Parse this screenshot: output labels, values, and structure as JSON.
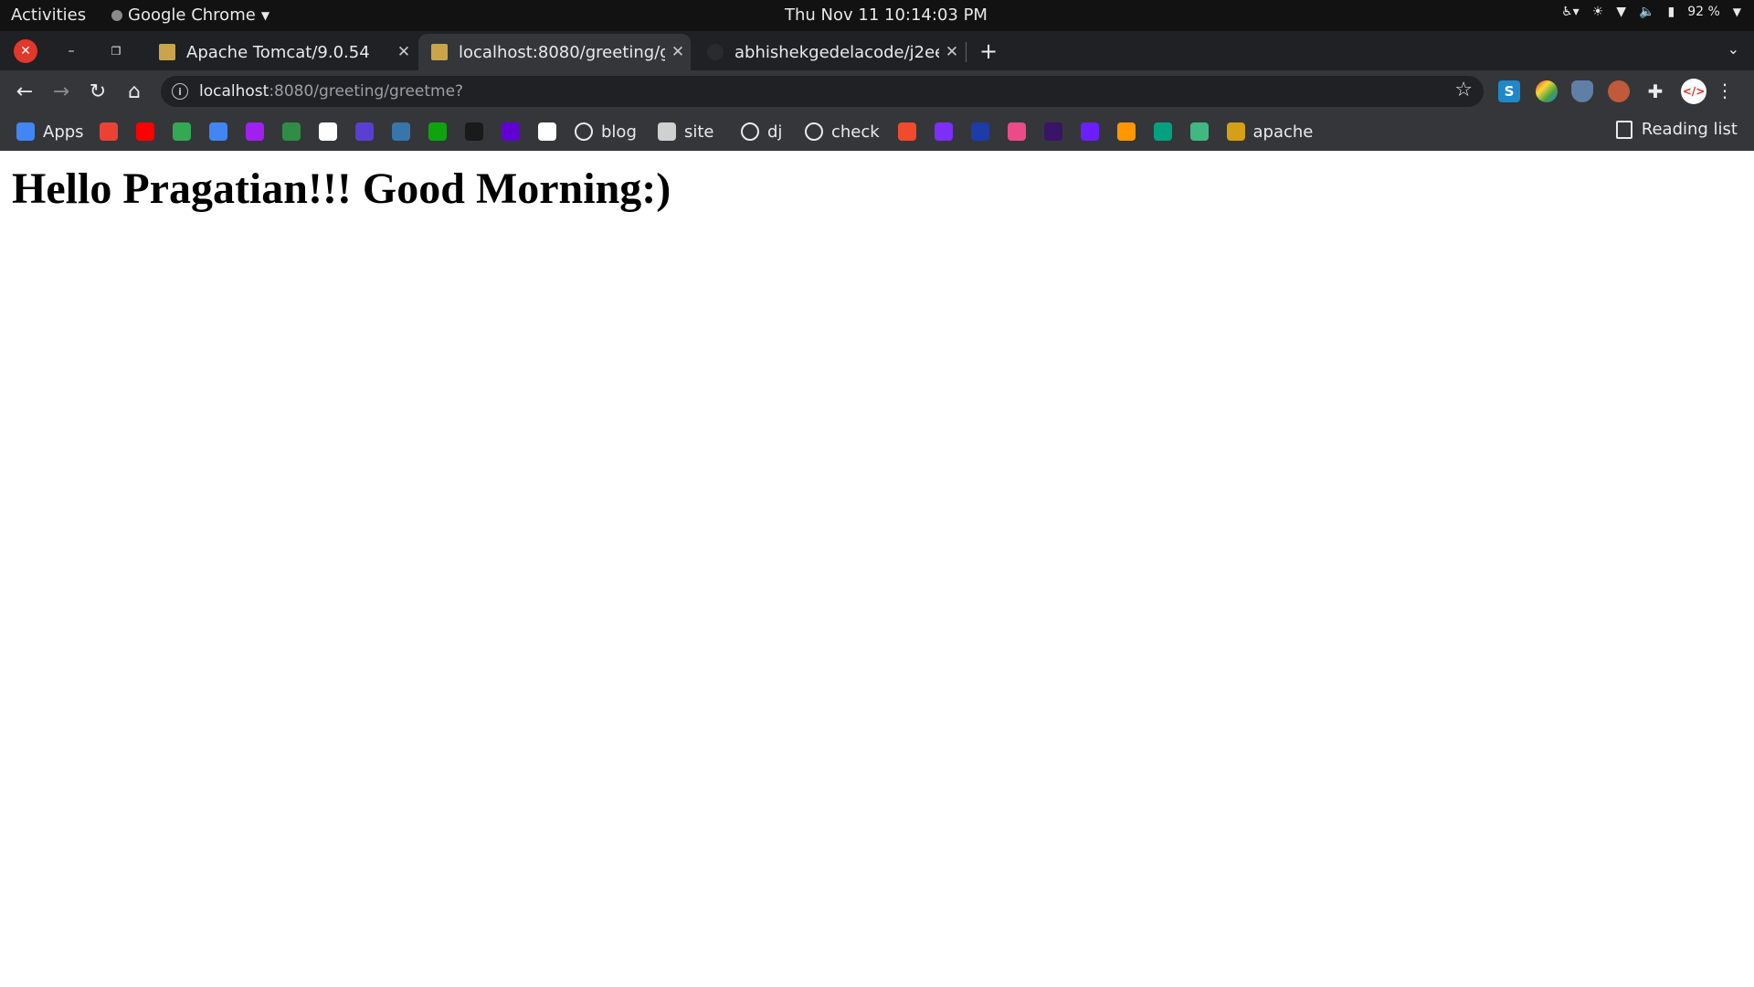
{
  "system_bar": {
    "activities": "Activities",
    "app_name": "Google Chrome",
    "clock": "Thu Nov 11  10:14:03 PM",
    "battery": "92 %"
  },
  "tabs": [
    {
      "title": "Apache Tomcat/9.0.54",
      "icon": "tomcat-icon",
      "active": false
    },
    {
      "title": "localhost:8080/greeting/g",
      "icon": "tomcat-icon",
      "active": true
    },
    {
      "title": "abhishekgedelacode/j2ee",
      "icon": "github-icon",
      "active": false
    }
  ],
  "address_bar": {
    "host": "localhost",
    "path": ":8080/greeting/greetme?"
  },
  "bookmarks": [
    {
      "label": "Apps",
      "icon": "apps-grid-icon",
      "color": "#4285f4"
    },
    {
      "label": "",
      "icon": "gmail-icon",
      "color": "#ea4335"
    },
    {
      "label": "",
      "icon": "youtube-icon",
      "color": "#ff0000"
    },
    {
      "label": "",
      "icon": "maps-icon",
      "color": "#34a853"
    },
    {
      "label": "",
      "icon": "translate-icon",
      "color": "#4285f4"
    },
    {
      "label": "",
      "icon": "app-f-icon",
      "color": "#a020f0"
    },
    {
      "label": "",
      "icon": "geeks-icon",
      "color": "#2f8d46"
    },
    {
      "label": "",
      "icon": "app-black-icon",
      "color": "#ffffff"
    },
    {
      "label": "",
      "icon": "app-purple-icon",
      "color": "#5b3fd1"
    },
    {
      "label": "",
      "icon": "python-icon",
      "color": "#3776ab"
    },
    {
      "label": "",
      "icon": "app-b-icon",
      "color": "#0fa30f"
    },
    {
      "label": "",
      "icon": "sf-icon",
      "color": "#1a1a1a"
    },
    {
      "label": "",
      "icon": "yahoo-icon",
      "color": "#6001d2"
    },
    {
      "label": "",
      "icon": "google-icon",
      "color": "#ffffff"
    },
    {
      "label": "blog",
      "icon": "globe-icon",
      "color": "#e8eaed"
    },
    {
      "label": "site",
      "icon": "code-icon",
      "color": "#d0d0d0"
    },
    {
      "label": "dj",
      "icon": "globe-icon",
      "color": "#e8eaed"
    },
    {
      "label": "check",
      "icon": "globe-icon",
      "color": "#e8eaed"
    },
    {
      "label": "",
      "icon": "app-orange-b-icon",
      "color": "#f24a2c"
    },
    {
      "label": "",
      "icon": "app-violet-icon",
      "color": "#7b2ff7"
    },
    {
      "label": "",
      "icon": "app-blue-icon",
      "color": "#1e3ca8"
    },
    {
      "label": "",
      "icon": "app-pink-icon",
      "color": "#ea4c89"
    },
    {
      "label": "",
      "icon": "app-dark-icon",
      "color": "#3a1466"
    },
    {
      "label": "",
      "icon": "app-square-icon",
      "color": "#6b1fff"
    },
    {
      "label": "",
      "icon": "app-multi-icon",
      "color": "#ff9800"
    },
    {
      "label": "",
      "icon": "px-icon",
      "color": "#05a081"
    },
    {
      "label": "",
      "icon": "vue-icon",
      "color": "#41b883"
    },
    {
      "label": "apache",
      "icon": "tomcat-icon",
      "color": "#d4a017"
    }
  ],
  "reading_list": "Reading list",
  "page": {
    "heading": "Hello Pragatian!!! Good Morning:)"
  }
}
